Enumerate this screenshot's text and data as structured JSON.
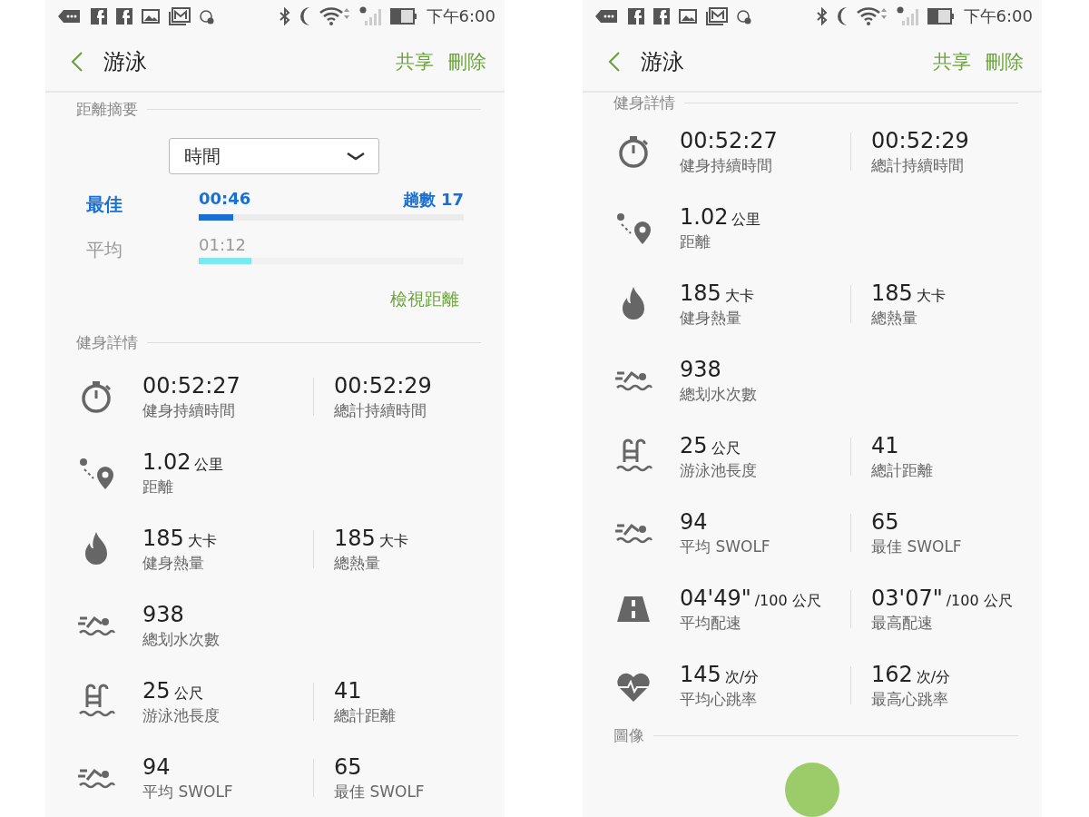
{
  "phones": [
    {
      "status_bar": {
        "time": "下午6:00"
      },
      "header": {
        "title": "游泳",
        "actions": [
          "共享",
          "刪除"
        ]
      },
      "sections": [
        {
          "kind": "summary",
          "title": "距離摘要",
          "dropdown": "時間",
          "best": {
            "label": "最佳",
            "value": "00:46",
            "laps": "趟數 17",
            "level": 0.13
          },
          "average": {
            "label": "平均",
            "value": "01:12",
            "level": 0.2
          },
          "link": "檢視距離"
        },
        {
          "kind": "details",
          "title": "健身詳情",
          "rows": [
            {
              "kind": "timer",
              "items": [
                {
                  "value": "00:52:27",
                  "label": "健身持續時間"
                },
                {
                  "value": "00:52:29",
                  "label": "總計持續時間"
                }
              ]
            },
            {
              "kind": "distance",
              "items": [
                {
                  "value": "1.02",
                  "unit": "公里",
                  "label": "距離"
                }
              ]
            },
            {
              "kind": "calories",
              "items": [
                {
                  "value": "185",
                  "unit": "大卡",
                  "label": "健身熱量"
                },
                {
                  "value": "185",
                  "unit": "大卡",
                  "label": "總熱量"
                }
              ]
            },
            {
              "kind": "strokes",
              "items": [
                {
                  "value": "938",
                  "label": "總划水次數"
                }
              ]
            },
            {
              "kind": "pool",
              "items": [
                {
                  "value": "25",
                  "unit": "公尺",
                  "label": "游泳池長度"
                },
                {
                  "value": "41",
                  "label": "總計距離"
                }
              ]
            },
            {
              "kind": "swolf",
              "items": [
                {
                  "value": "94",
                  "label": "平均 SWOLF"
                },
                {
                  "value": "65",
                  "label": "最佳 SWOLF"
                }
              ]
            }
          ]
        }
      ]
    },
    {
      "status_bar": {
        "time": "下午6:00"
      },
      "header": {
        "title": "游泳",
        "actions": [
          "共享",
          "刪除"
        ]
      },
      "sections": [
        {
          "kind": "details",
          "title": "健身詳情",
          "rows": [
            {
              "kind": "timer",
              "items": [
                {
                  "value": "00:52:27",
                  "label": "健身持續時間"
                },
                {
                  "value": "00:52:29",
                  "label": "總計持續時間"
                }
              ]
            },
            {
              "kind": "distance",
              "items": [
                {
                  "value": "1.02",
                  "unit": "公里",
                  "label": "距離"
                }
              ]
            },
            {
              "kind": "calories",
              "items": [
                {
                  "value": "185",
                  "unit": "大卡",
                  "label": "健身熱量"
                },
                {
                  "value": "185",
                  "unit": "大卡",
                  "label": "總熱量"
                }
              ]
            },
            {
              "kind": "strokes",
              "items": [
                {
                  "value": "938",
                  "label": "總划水次數"
                }
              ]
            },
            {
              "kind": "pool",
              "items": [
                {
                  "value": "25",
                  "unit": "公尺",
                  "label": "游泳池長度"
                },
                {
                  "value": "41",
                  "label": "總計距離"
                }
              ]
            },
            {
              "kind": "swolf",
              "items": [
                {
                  "value": "94",
                  "label": "平均 SWOLF"
                },
                {
                  "value": "65",
                  "label": "最佳 SWOLF"
                }
              ]
            },
            {
              "kind": "pace",
              "items": [
                {
                  "value": "04'49\"",
                  "unit": "/100 公尺",
                  "label": "平均配速"
                },
                {
                  "value": "03'07\"",
                  "unit": "/100 公尺",
                  "label": "最高配速"
                }
              ]
            },
            {
              "kind": "heart",
              "items": [
                {
                  "value": "145",
                  "unit": "次/分",
                  "label": "平均心跳率"
                },
                {
                  "value": "162",
                  "unit": "次/分",
                  "label": "最高心跳率"
                }
              ]
            }
          ]
        },
        {
          "kind": "images",
          "title": "圖像"
        }
      ]
    }
  ]
}
